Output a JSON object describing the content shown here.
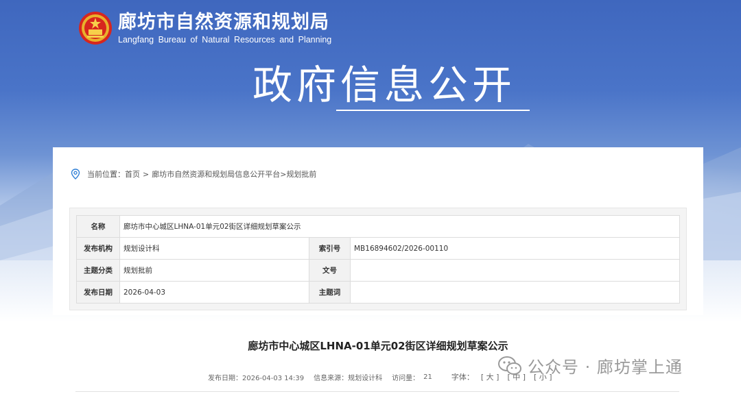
{
  "header": {
    "org_name_cn": "廊坊市自然资源和规划局",
    "org_name_en": "Langfang Bureau of Natural Resources and Planning",
    "section_title": "政府信息公开"
  },
  "breadcrumb": {
    "prefix": "当前位置：",
    "items": [
      "首页",
      "廊坊市自然资源和规划局信息公开平台",
      "规划批前"
    ],
    "separators": [
      ">",
      ">"
    ]
  },
  "meta": {
    "name_label": "名称",
    "name_value": "廊坊市中心城区LHNA-01单元02街区详细规划草案公示",
    "publisher_label": "发布机构",
    "publisher_value": "规划设计科",
    "index_label": "索引号",
    "index_value": "MB16894602/2026-00110",
    "category_label": "主题分类",
    "category_value": "规划批前",
    "docno_label": "文号",
    "docno_value": "",
    "date_label": "发布日期",
    "date_value": "2026-04-03",
    "keyword_label": "主题词",
    "keyword_value": ""
  },
  "article": {
    "title": "廊坊市中心城区LHNA-01单元02街区详细规划草案公示",
    "publish_date": "发布日期：2026-04-03 14:39",
    "source": "信息来源：规划设计科",
    "views_label": "访问量：",
    "views_value": "21",
    "font_label": "字体：",
    "font_large": "[ 大 ]",
    "font_medium": "[ 中 ]",
    "font_small": "[ 小 ]"
  },
  "watermark": {
    "text": "公众号 · 廊坊掌上通",
    "icon": "wechat-icon"
  },
  "colors": {
    "banner_blue": "#3f67be",
    "text_dark": "#222222",
    "label_bg": "#f2f2f2",
    "pin_blue": "#2f7fd6"
  }
}
